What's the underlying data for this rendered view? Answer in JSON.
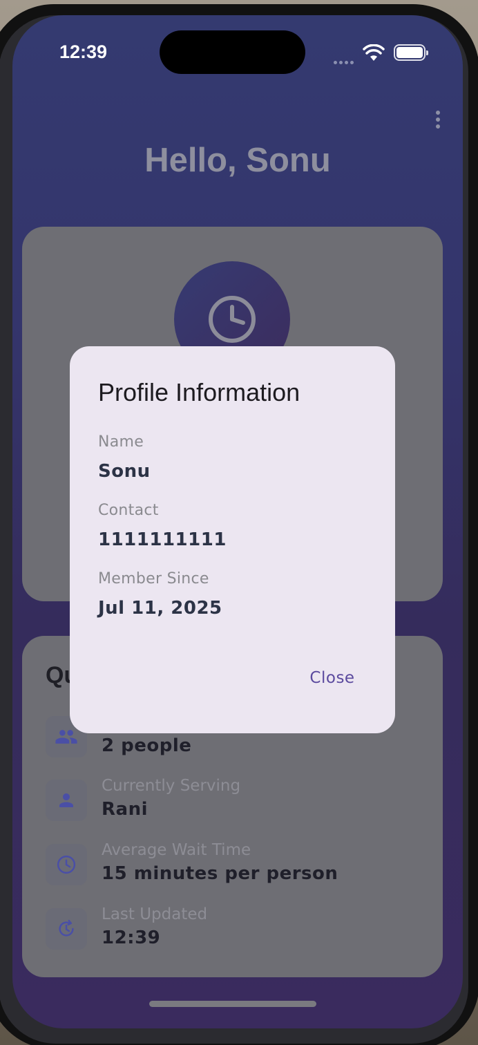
{
  "status_bar": {
    "time": "12:39"
  },
  "header": {
    "greeting": "Hello, Sonu"
  },
  "queue": {
    "title": "Qu",
    "rows": [
      {
        "icon": "people-icon",
        "label": "",
        "value": "2 people"
      },
      {
        "icon": "person-icon",
        "label": "Currently Serving",
        "value": "Rani"
      },
      {
        "icon": "clock-icon",
        "label": "Average Wait Time",
        "value": "15 minutes per person"
      },
      {
        "icon": "refresh-clock-icon",
        "label": "Last Updated",
        "value": "12:39"
      }
    ]
  },
  "dialog": {
    "title": "Profile Information",
    "fields": [
      {
        "label": "Name",
        "value": "Sonu"
      },
      {
        "label": "Contact",
        "value": "1111111111"
      },
      {
        "label": "Member Since",
        "value": "Jul 11, 2025"
      }
    ],
    "close_label": "Close"
  },
  "colors": {
    "accent": "#5b4a9e",
    "dialog_bg": "#ece6f1",
    "screen_gradient_top": "#343a70",
    "screen_gradient_bottom": "#3a2b5e",
    "icon_tint": "#4a4fa6"
  }
}
